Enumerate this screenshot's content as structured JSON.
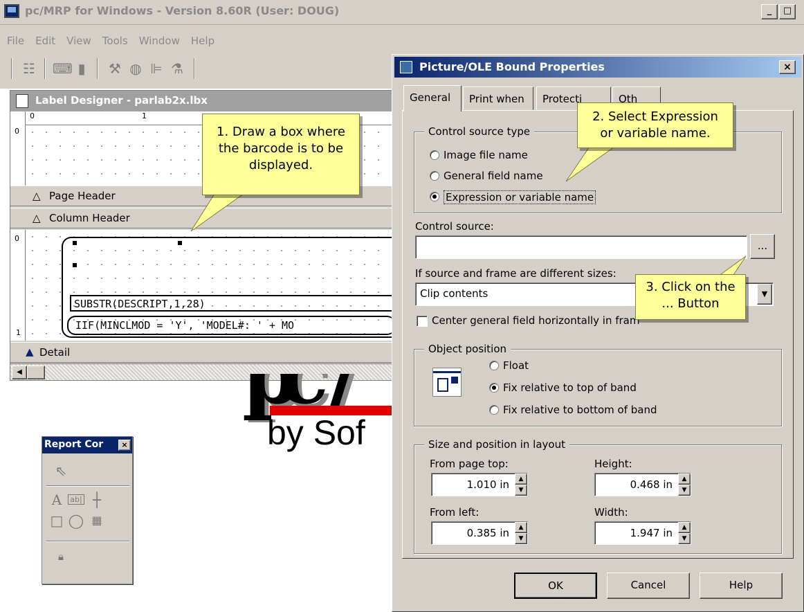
{
  "main_window": {
    "title": "pc/MRP for Windows - Version 8.60R  (User: DOUG)",
    "menu": [
      "File",
      "Edit",
      "View",
      "Tools",
      "Window",
      "Help"
    ],
    "toolbar_icons": [
      "tree-icon",
      "keyboard-icon",
      "page-icon",
      "tools-icon",
      "globe-icon",
      "align-icon",
      "wizard-icon"
    ]
  },
  "label_designer": {
    "title": "Label Designer - parlab2x.lbx",
    "ruler_top": [
      "0",
      "1"
    ],
    "ruler_left": [
      "0",
      "0",
      "1"
    ],
    "bands": {
      "page_header": "Page Header",
      "column_header": "Column Header",
      "detail": "Detail"
    },
    "fields": [
      "SUBSTR(DESCRIPT,1,28)",
      "IIF(MINCLMOD = 'Y', 'MODEL#: ' + MO"
    ]
  },
  "background_logo": {
    "text": "by Sof",
    "accent_color": "#e00000"
  },
  "report_controls": {
    "title": "Report Cor"
  },
  "dialog": {
    "title": "Picture/OLE Bound Properties",
    "tabs": [
      "General",
      "Print when",
      "Protecti",
      "Oth"
    ],
    "control_source_type": {
      "label": "Control source type",
      "options": [
        "Image file name",
        "General field name",
        "Expression or variable name"
      ],
      "selected": 2
    },
    "control_source": {
      "label": "Control source:",
      "value": "",
      "browse_label": "..."
    },
    "frame_sizes": {
      "label": "If source and frame are different sizes:",
      "value": "Clip contents"
    },
    "center_checkbox": {
      "label": "Center general field horizontally in fram",
      "checked": false
    },
    "object_position": {
      "label": "Object position",
      "options": [
        "Float",
        "Fix relative to top of band",
        "Fix relative to bottom of band"
      ],
      "selected": 1
    },
    "size_position": {
      "label": "Size and position in layout",
      "from_page_top_label": "From page top:",
      "from_page_top": "1.010 in",
      "height_label": "Height:",
      "height": "0.468 in",
      "from_left_label": "From left:",
      "from_left": "0.385 in",
      "width_label": "Width:",
      "width": "1.947 in"
    },
    "buttons": {
      "ok": "OK",
      "cancel": "Cancel",
      "help": "Help"
    }
  },
  "callouts": {
    "one": [
      "1. Draw a box where",
      "the barcode is to be",
      "displayed."
    ],
    "two": [
      "2. Select Expression",
      "or variable name."
    ],
    "three": [
      "3. Click on the",
      "... Button"
    ]
  }
}
